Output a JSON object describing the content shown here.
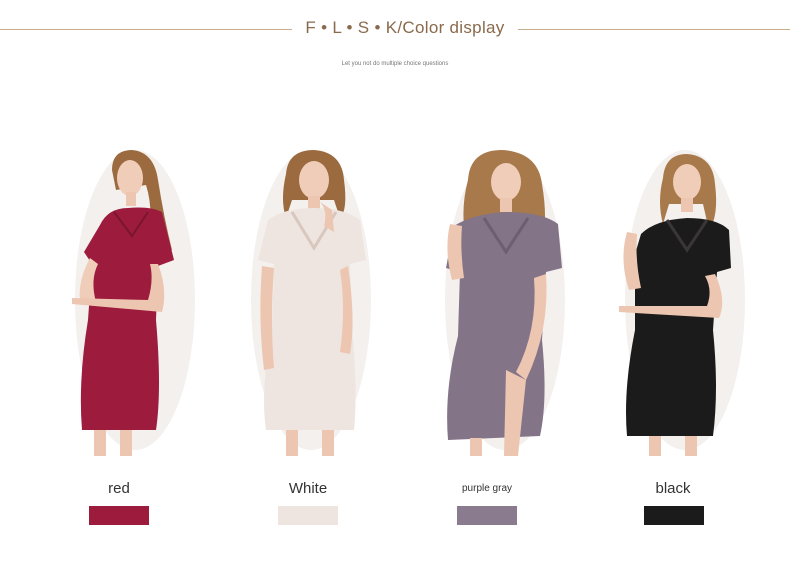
{
  "header": {
    "title": "F • L • S • K/Color display",
    "subtitle": "Let you not do multiple choice questions"
  },
  "colors": [
    {
      "label": "red",
      "hex": "#9d1b3c"
    },
    {
      "label": "White",
      "hex": "#efe5e0"
    },
    {
      "label": "purple gray",
      "hex": "#8b7b8f"
    },
    {
      "label": "black",
      "hex": "#1c1b1b"
    }
  ]
}
